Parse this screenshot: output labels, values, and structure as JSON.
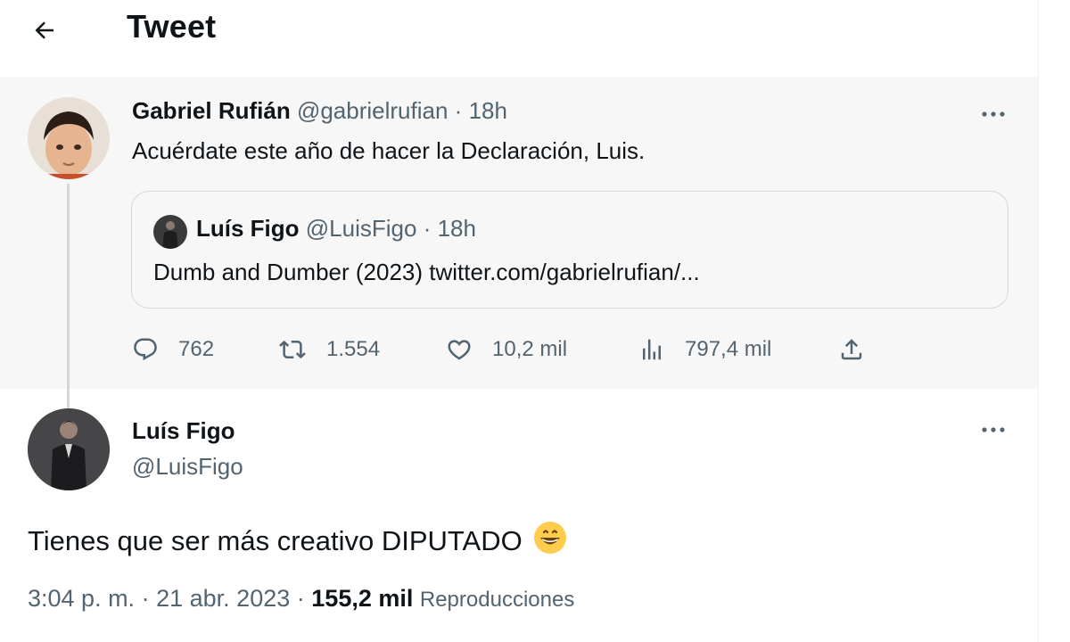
{
  "header": {
    "title": "Tweet"
  },
  "parent_tweet": {
    "author_name": "Gabriel Rufián",
    "author_handle": "@gabrielrufian",
    "separator": "·",
    "time": "18h",
    "text": "Acuérdate este año de hacer la Declaración, Luis.",
    "quoted": {
      "author_name": "Luís Figo",
      "author_handle": "@LuisFigo",
      "separator": "·",
      "time": "18h",
      "text": "Dumb and Dumber (2023) twitter.com/gabrielrufian/..."
    },
    "actions": {
      "replies": "762",
      "retweets": "1.554",
      "likes": "10,2 mil",
      "views": "797,4 mil"
    }
  },
  "main_tweet": {
    "author_name": "Luís Figo",
    "author_handle": "@LuisFigo",
    "text": "Tienes que ser más creativo DIPUTADO",
    "time": "3:04 p. m.",
    "separator": "·",
    "date": "21 abr. 2023",
    "views_count": "155,2 mil",
    "views_label": "Reproducciones"
  },
  "icons": {
    "back": "arrow-left-icon",
    "more": "more-horizontal-icon",
    "reply": "reply-icon",
    "retweet": "retweet-icon",
    "like": "heart-icon",
    "views": "analytics-icon",
    "share": "share-icon",
    "emoji": "grinning-face-emoji"
  },
  "colors": {
    "text": "#0f1419",
    "muted": "#536471",
    "border": "#cfd9de",
    "parent_bg": "#f7f7f7"
  }
}
